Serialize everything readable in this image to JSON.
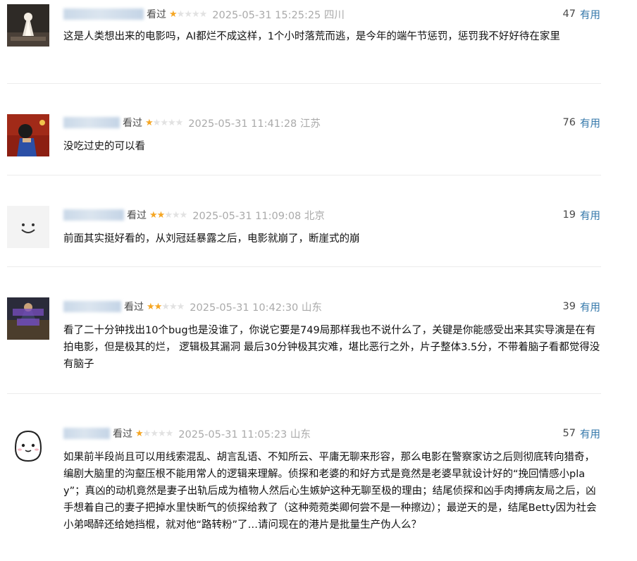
{
  "comments": [
    {
      "status": "看过",
      "rating": 1,
      "time": "2025-05-31 15:25:25 四川",
      "votes": "47",
      "useful_label": "有用",
      "text": "这是人类想出来的电影吗，AI都烂不成这样，1个小时落荒而逃，是今年的端午节惩罚，惩罚我不好好待在家里"
    },
    {
      "status": "看过",
      "rating": 1,
      "time": "2025-05-31 11:41:28 江苏",
      "votes": "76",
      "useful_label": "有用",
      "text": "没吃过史的可以看"
    },
    {
      "status": "看过",
      "rating": 2,
      "time": "2025-05-31 11:09:08 北京",
      "votes": "19",
      "useful_label": "有用",
      "text": "前面其实挺好看的，从刘冠廷暴露之后，电影就崩了，断崖式的崩"
    },
    {
      "status": "看过",
      "rating": 2,
      "time": "2025-05-31 10:42:30 山东",
      "votes": "39",
      "useful_label": "有用",
      "text": "看了二十分钟找出10个bug也是没谁了，你说它要是749局那样我也不说什么了，关键是你能感受出来其实导演是在有拍电影，但是极其的烂， 逻辑极其漏洞 最后30分钟极其灾难，堪比恶行之外，片子整体3.5分，不带着脑子看都觉得没有脑子"
    },
    {
      "status": "看过",
      "rating": 1,
      "time": "2025-05-31 11:05:23 山东",
      "votes": "57",
      "useful_label": "有用",
      "text": "如果前半段尚且可以用线索混乱、胡言乱语、不知所云、平庸无聊来形容，那么电影在警察家访之后则彻底转向猎奇，编剧大脑里的沟壑压根不能用常人的逻辑来理解。侦探和老婆的和好方式是竟然是老婆早就设计好的“挽回情感小play”；真凶的动机竟然是妻子出轨后成为植物人然后心生嫉妒这种无聊至极的理由；结尾侦探和凶手肉搏病友局之后，凶手想着自己的妻子把掉水里快断气的侦探给救了（这种菀菀类卿何尝不是一种擦边）；最逆天的是，结尾Betty因为社会小弟喝醉还给她挡棍，就对他“路转粉”了…请问现在的港片是批量生产伪人么？"
    }
  ]
}
